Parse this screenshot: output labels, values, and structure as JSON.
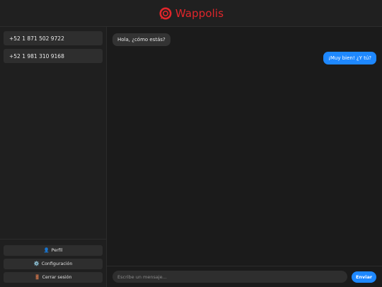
{
  "header": {
    "brand": "Wappolis",
    "logo_icon": "wappolis-logo-icon",
    "brand_color": "#e0262b"
  },
  "sidebar": {
    "contacts": [
      {
        "label": "+52 1 871 502 9722"
      },
      {
        "label": "+52 1 981 310 9168"
      }
    ],
    "actions": [
      {
        "label": "Perfil",
        "icon": "user-icon",
        "glyph": "👤"
      },
      {
        "label": "Configuración",
        "icon": "gear-icon",
        "glyph": "⚙️"
      },
      {
        "label": "Cerrar sesión",
        "icon": "door-icon",
        "glyph": "🚪"
      }
    ]
  },
  "chat": {
    "messages": [
      {
        "direction": "in",
        "text": "Hola, ¿cómo estás?"
      },
      {
        "direction": "out",
        "text": "¡Muy bien! ¿Y tú?"
      }
    ],
    "input": {
      "value": "",
      "placeholder": "Escribe un mensaje..."
    },
    "send_label": "Enviar",
    "accent": "#1e88ff"
  }
}
